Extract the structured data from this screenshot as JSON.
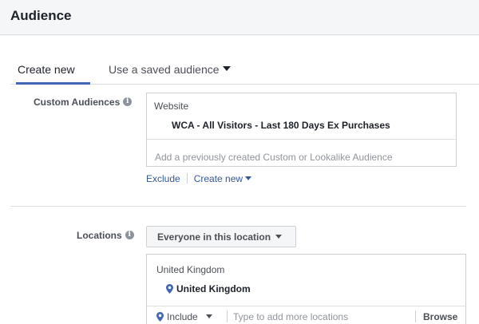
{
  "header": {
    "title": "Audience"
  },
  "tabs": [
    {
      "label": "Create new",
      "active": true
    },
    {
      "label": "Use a saved audience",
      "active": false
    }
  ],
  "custom_audiences": {
    "label": "Custom Audiences",
    "info_icon": "info-icon",
    "selected_type": "Website",
    "selected_audience": "WCA - All Visitors - Last 180 Days Ex Purchases",
    "placeholder": "Add a previously created Custom or Lookalike Audience",
    "links": {
      "exclude": "Exclude",
      "create_new": "Create new"
    }
  },
  "locations": {
    "label": "Locations",
    "info_icon": "info-icon",
    "scope_select": "Everyone in this location",
    "country_heading": "United Kingdom",
    "selected_location": "United Kingdom",
    "include_select": "Include",
    "placeholder": "Type to add more locations",
    "browse_label": "Browse"
  },
  "colors": {
    "link": "#365899",
    "accent": "#4267b2",
    "pin": "#4267b2"
  }
}
